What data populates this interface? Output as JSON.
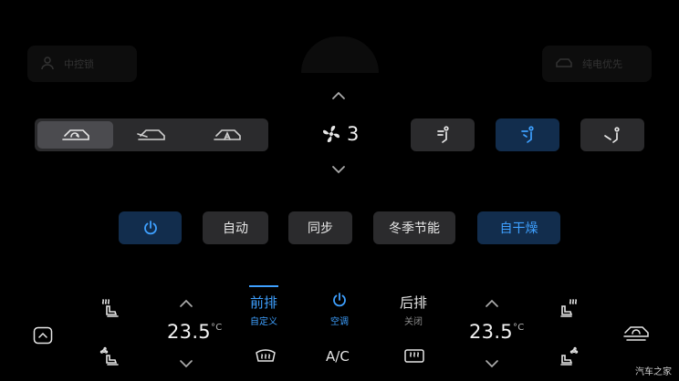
{
  "bg_hints": {
    "left_ghost": "中控锁",
    "right_ghost": "纯电优先"
  },
  "fan": {
    "level": "3"
  },
  "modes": {
    "auto": "自动",
    "sync": "同步",
    "winter": "冬季节能",
    "dry": "自干燥"
  },
  "front": {
    "title": "前排",
    "sub": "自定义"
  },
  "ac_power": {
    "label": "空调"
  },
  "rear": {
    "title": "后排",
    "sub": "关闭"
  },
  "ac": {
    "label": "A/C"
  },
  "left_temp": {
    "value": "23.5",
    "unit": "°C"
  },
  "right_temp": {
    "value": "23.5",
    "unit": "°C"
  },
  "watermark": "汽车之家",
  "colors": {
    "accent": "#3ea0ff",
    "button_bg": "#2b2b2d",
    "active_bg": "#122d4d"
  }
}
